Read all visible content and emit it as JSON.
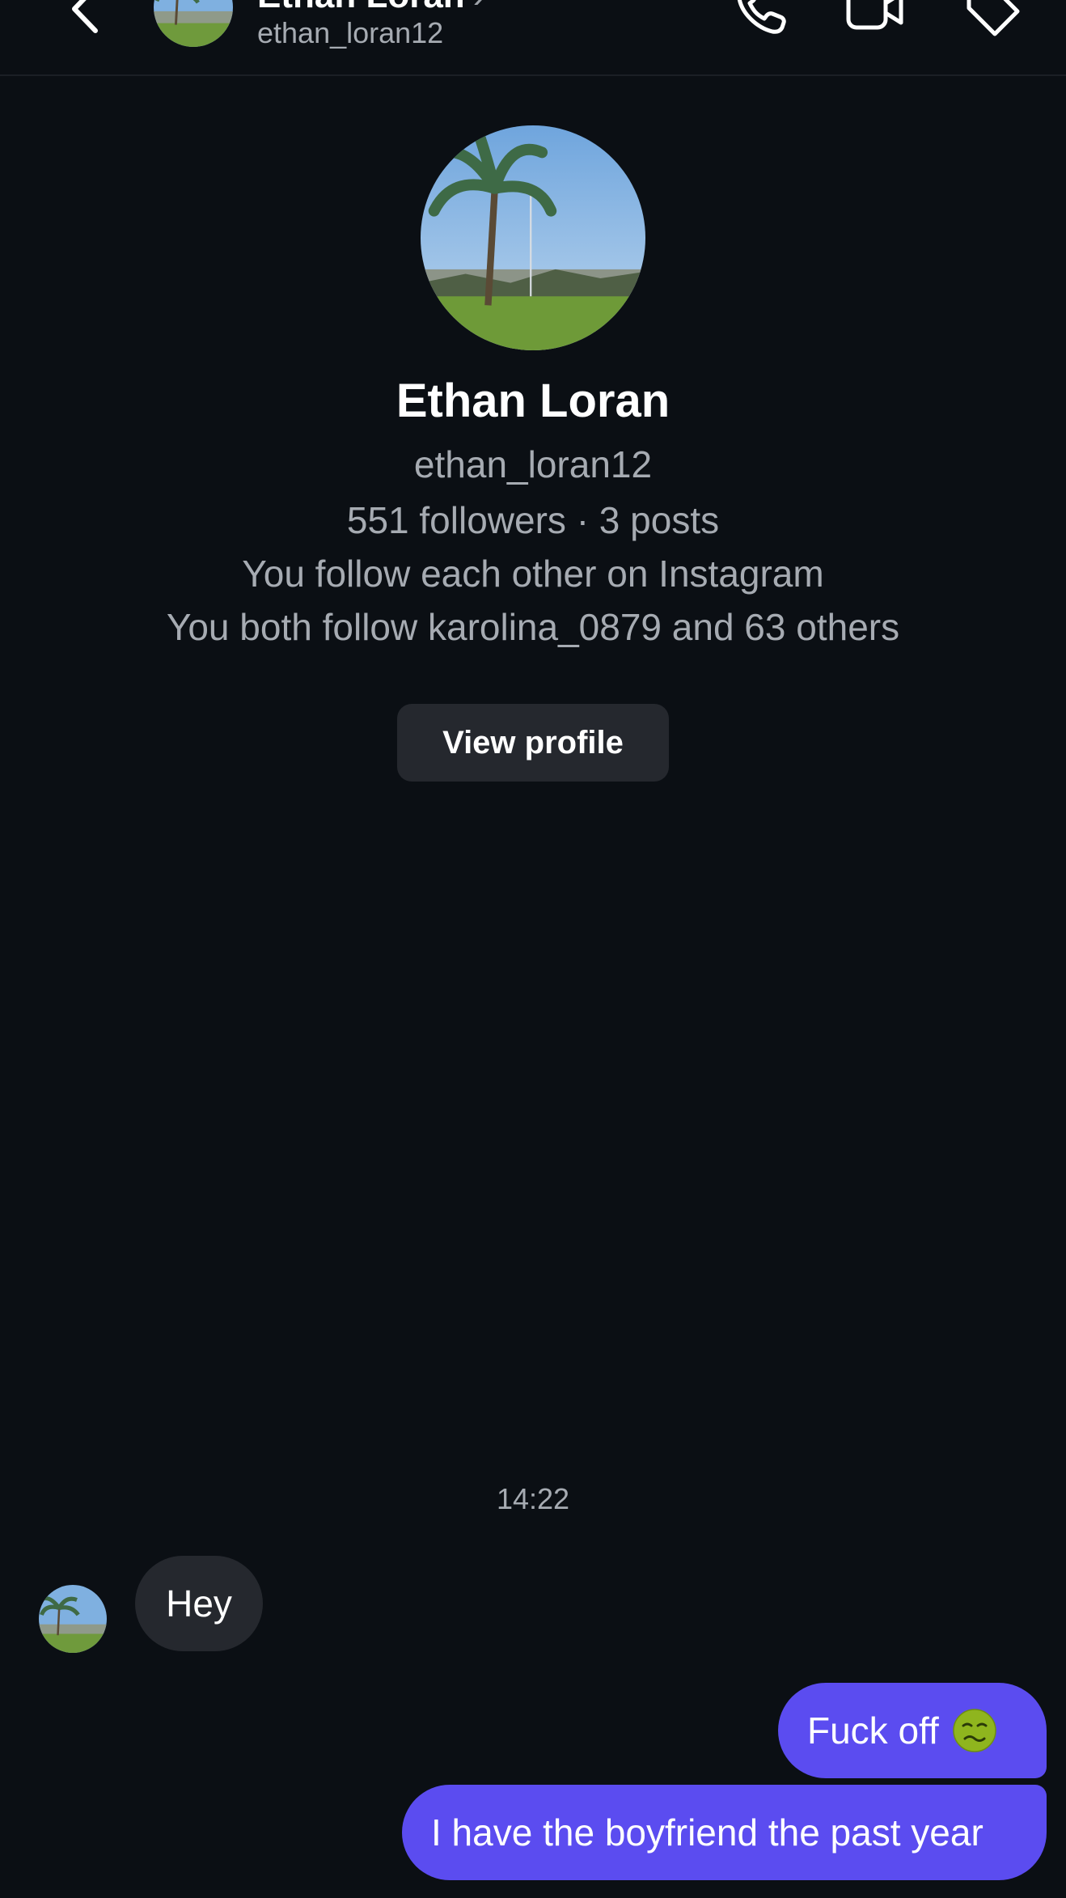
{
  "header": {
    "contact_name": "Ethan Loran",
    "contact_username": "ethan_loran12",
    "chevron": "›",
    "icons": [
      "back-icon",
      "phone-icon",
      "video-camera-icon",
      "tag-icon"
    ]
  },
  "profile": {
    "name": "Ethan Loran",
    "username": "ethan_loran12",
    "stats": "551 followers · 3 posts",
    "relationship": "You follow each other on Instagram",
    "mutual_followers": "You both follow karolina_0879 and 63 others",
    "view_profile_label": "View profile"
  },
  "conversation": {
    "timestamp": "14:22",
    "messages": [
      {
        "direction": "incoming",
        "text": "Hey"
      },
      {
        "direction": "outgoing",
        "text": "Fuck off",
        "emoji": "nauseated-face-icon"
      },
      {
        "direction": "outgoing",
        "text": "I have the boyfriend the past year"
      }
    ]
  },
  "colors": {
    "background": "#0b0f14",
    "incoming_bubble": "#25282e",
    "outgoing_bubble": "#5b4cf0",
    "secondary_text": "#a6abb2"
  }
}
